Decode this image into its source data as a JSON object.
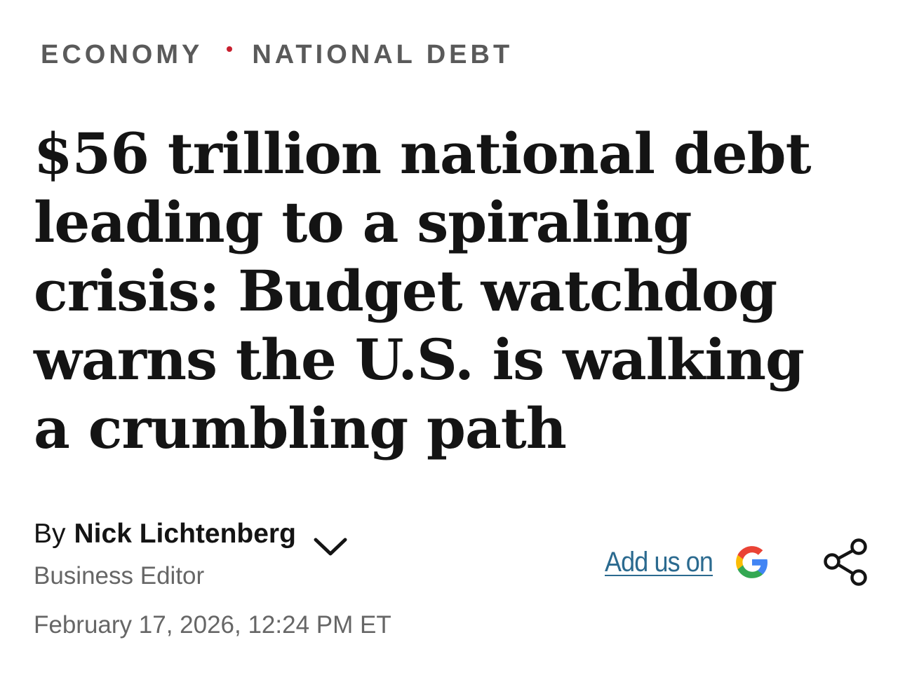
{
  "breadcrumb": {
    "section": "ECONOMY",
    "topic": "NATIONAL DEBT",
    "separator_color": "#c8202f"
  },
  "article": {
    "headline": "$56 trillion national debt leading to a spiraling crisis: Budget watchdog warns the U.S. is walking a crumbling path",
    "byline_prefix": "By",
    "author_name": "Nick Lichtenberg",
    "author_role": "Business Editor",
    "published": "February 17, 2026, 12:24 PM ET"
  },
  "actions": {
    "add_google_label": "Add us on",
    "add_google_icon": "google-g-icon",
    "share_icon": "share-icon",
    "author_expand_icon": "chevron-down-icon",
    "link_color": "#2b6a8f"
  }
}
